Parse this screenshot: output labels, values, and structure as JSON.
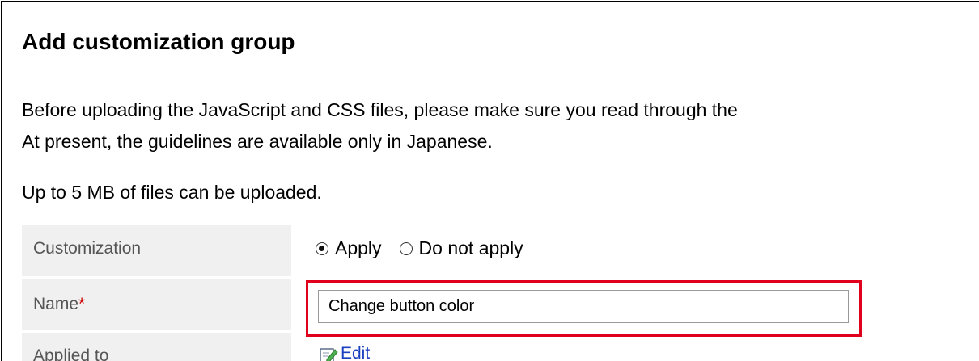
{
  "page": {
    "title": "Add customization group",
    "intro_line1": "Before uploading the JavaScript and CSS files, please make sure you read through the",
    "intro_line2": "At present, the guidelines are available only in Japanese.",
    "upload_note": "Up to 5 MB of files can be uploaded."
  },
  "form": {
    "customization": {
      "label": "Customization",
      "options": [
        {
          "label": "Apply",
          "selected": true
        },
        {
          "label": "Do not apply",
          "selected": false
        }
      ]
    },
    "name": {
      "label": "Name",
      "required_mark": "*",
      "value": "Change button color"
    },
    "applied_to": {
      "label": "Applied to",
      "edit_label": "Edit"
    }
  },
  "colors": {
    "highlight": "#e0001b",
    "label_background": "#f0f0f0",
    "link": "#1a3fbf",
    "required": "#cc0000"
  },
  "icons": {
    "edit": "pencil-edit-icon"
  }
}
